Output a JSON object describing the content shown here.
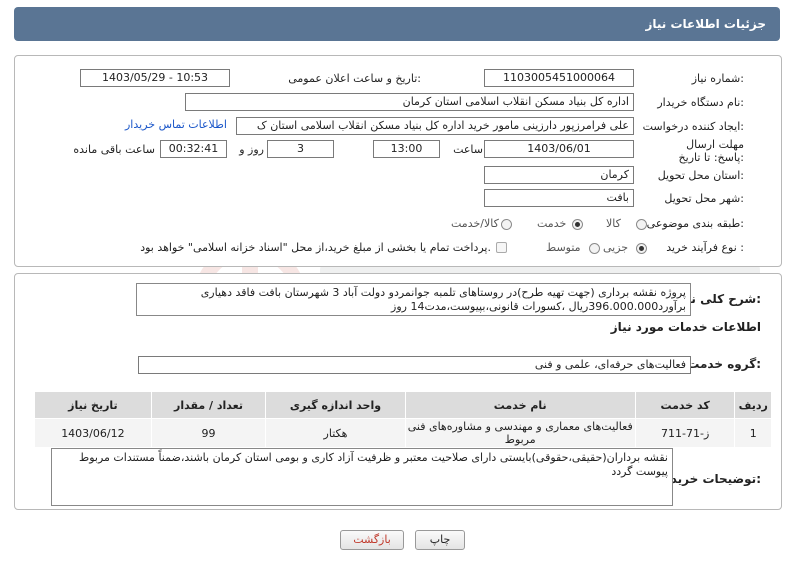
{
  "header": {
    "title": "جزئیات اطلاعات نیاز"
  },
  "fields": {
    "need_number_label": "شماره نیاز:",
    "need_number": "1103005451000064",
    "announce_label": "تاریخ و ساعت اعلان عمومی:",
    "announce_value": "1403/05/29 - 10:53",
    "buyer_org_label": "نام دستگاه خریدار:",
    "buyer_org": "اداره کل بنیاد مسکن انقلاب اسلامی استان کرمان",
    "creator_label": "ایجاد کننده درخواست:",
    "creator": "علی فرامرزپور دارزینی مامور خرید اداره کل بنیاد مسکن انقلاب اسلامی استان ک",
    "contact_link": "اطلاعات تماس خریدار",
    "deadline_label": "مهلت ارسال پاسخ: تا تاریخ:",
    "deadline_date": "1403/06/01",
    "time_label": "ساعت",
    "deadline_time": "13:00",
    "days_value": "3",
    "days_label": "روز و",
    "remaining_time": "00:32:41",
    "remaining_label": "ساعت باقی مانده",
    "province_label": "استان محل تحویل:",
    "province": "کرمان",
    "city_label": "شهر محل تحویل:",
    "city": "بافت",
    "category_label": "طبقه بندی موضوعی:",
    "category_options": [
      "کالا",
      "خدمت",
      "کالا/خدمت"
    ],
    "category_selected": "خدمت",
    "process_label": "نوع فرآیند خرید :",
    "process_options": [
      "جزیی",
      "متوسط"
    ],
    "process_selected": "جزیی",
    "payment_note": "پرداخت تمام یا بخشی از مبلغ خرید،از محل \"اسناد خزانه اسلامی\" خواهد بود."
  },
  "summary": {
    "label": "شرح کلی نیاز:",
    "text": "پروژه نقشه برداری (جهت تهیه طرح)در روستاهای تلمبه جوانمردو دولت آباد 3 شهرستان بافت فاقد دهیاری برآورد396.000.000ریال ،کسورات قانونی،بپیوست،مدت14 روز"
  },
  "services": {
    "section_title": "اطلاعات خدمات مورد نیاز",
    "group_label": "گروه خدمت:",
    "group_value": "فعالیت‌های حرفه‌ای، علمی و فنی",
    "columns": [
      "ردیف",
      "کد خدمت",
      "نام خدمت",
      "واحد اندازه گیری",
      "تعداد / مقدار",
      "تاریخ نیاز"
    ],
    "rows": [
      [
        "1",
        "ز-71-711",
        "فعالیت‌های معماری و مهندسی و مشاوره‌های فنی مربوط",
        "هکتار",
        "99",
        "1403/06/12"
      ]
    ]
  },
  "buyer_notes": {
    "label": "توضیحات خریدار:",
    "text": "نقشه برداران(حقیقی،حقوقی)بایستی دارای صلاحیت معتبر و ظرفیت آزاد کاری و بومی استان کرمان باشند،ضمناً مستندات مربوط پیوست گردد"
  },
  "buttons": {
    "print": "چاپ",
    "back": "بازگشت"
  },
  "colors": {
    "header_bg": "#5a7594",
    "link": "#1a56c9",
    "back_text": "#c0392b"
  }
}
